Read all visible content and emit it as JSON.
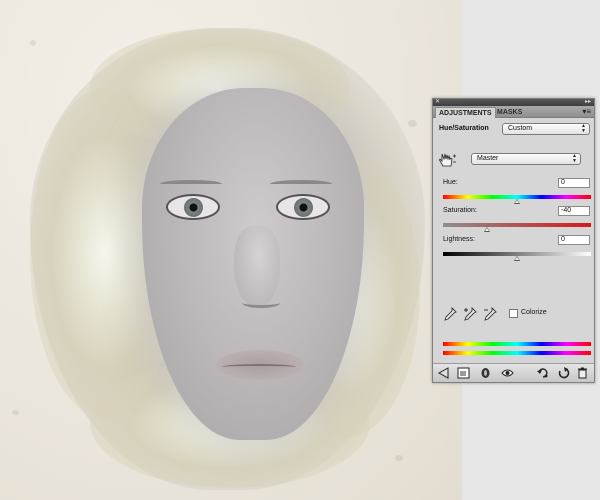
{
  "document": {
    "subject": "portrait-photo"
  },
  "panel": {
    "tabs": [
      {
        "label": "ADJUSTMENTS",
        "active": true
      },
      {
        "label": "MASKS",
        "active": false
      }
    ],
    "adjustment_title": "Hue/Saturation",
    "preset": "Custom",
    "channel": "Master",
    "hue": {
      "label": "Hue:",
      "value": "0",
      "min": -180,
      "max": 180
    },
    "saturation": {
      "label": "Saturation:",
      "value": "-40",
      "min": -100,
      "max": 100
    },
    "lightness": {
      "label": "Lightness:",
      "value": "0",
      "min": -100,
      "max": 100
    },
    "colorize": {
      "label": "Colorize",
      "checked": false
    },
    "eyedropper_icons": [
      "eyedropper-icon",
      "eyedropper-plus-icon",
      "eyedropper-minus-icon"
    ],
    "bottom_icons": [
      "back-arrow-icon",
      "expand-view-icon",
      "clip-to-layer-icon",
      "visibility-eye-icon",
      "view-previous-icon",
      "reset-icon",
      "trash-icon"
    ],
    "colors": {
      "panel_bg": "#d6d6d6",
      "titlebar": "#3d3d3d",
      "saturation_end": "#d81818"
    }
  }
}
